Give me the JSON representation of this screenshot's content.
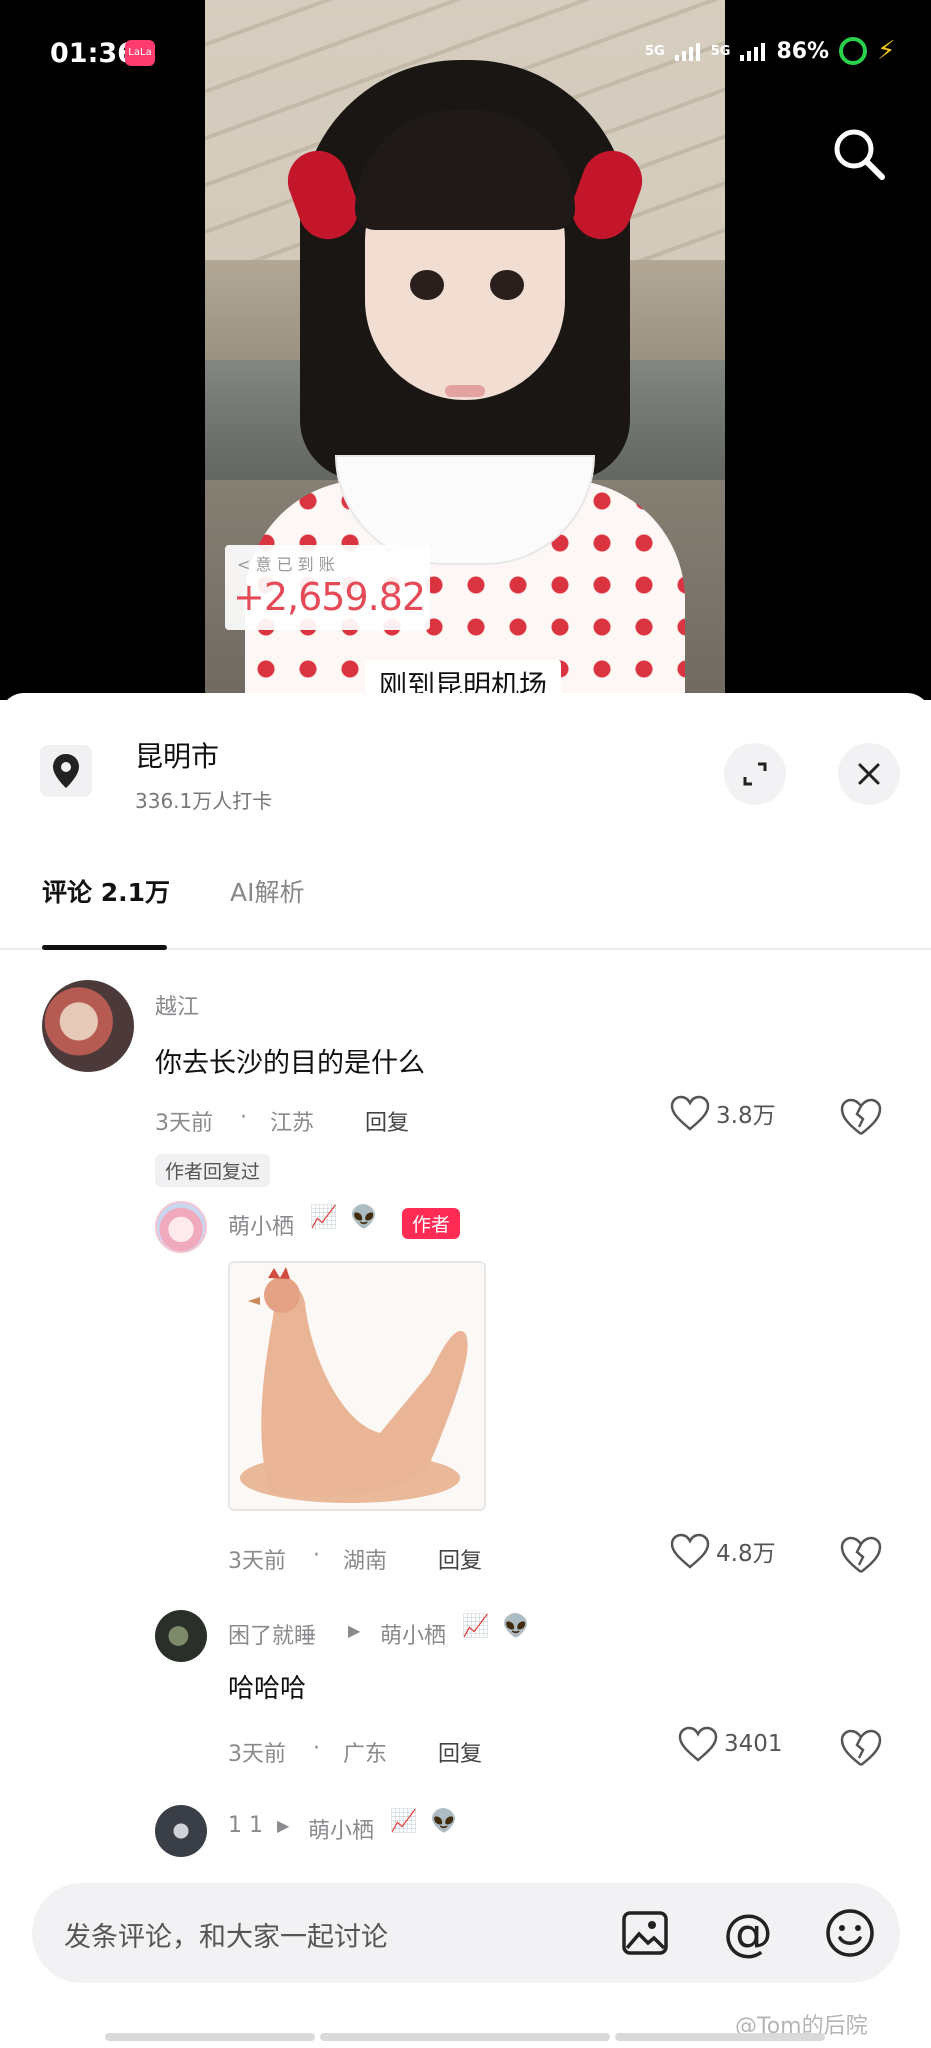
{
  "status": {
    "time": "01:36",
    "app_badge": "LaLa",
    "signal1": "5G",
    "signal2": "5G",
    "battery": "86%"
  },
  "video": {
    "money_sub": "< 意 已 到 账",
    "money": "+2,659.82",
    "caption": "刚到昆明机场"
  },
  "location": {
    "title": "昆明市",
    "subtitle": "336.1万人打卡"
  },
  "tabs": [
    {
      "label": "评论 2.1万"
    },
    {
      "label": "AI解析"
    }
  ],
  "comments": [
    {
      "name": "越江",
      "text": "你去长沙的目的是什么",
      "time": "3天前",
      "dot": "·",
      "region": "江苏",
      "reply": "回复",
      "likes": "3.8万"
    }
  ],
  "author_replied_tag": "作者回复过",
  "replies": [
    {
      "name": "萌小栖",
      "badge": "作者",
      "time": "3天前",
      "dot": "·",
      "region": "湖南",
      "reply": "回复",
      "likes": "4.8万"
    },
    {
      "name": "困了就睡",
      "to": "萌小栖",
      "text": "哈哈哈",
      "time": "3天前",
      "dot": "·",
      "region": "广东",
      "reply": "回复",
      "likes": "3401"
    },
    {
      "name": "1 1",
      "to": "萌小栖"
    }
  ],
  "input": {
    "placeholder": "发条评论，和大家一起讨论",
    "at": "@"
  },
  "watermark": "@Tom的后院",
  "colors": {
    "accent": "#fe2c55",
    "battery": "#2bd04d",
    "money": "#e44b57"
  },
  "icons": [
    "search-icon",
    "location-pin-icon",
    "expand-icon",
    "close-icon",
    "heart-icon",
    "broken-heart-icon",
    "image-icon",
    "at-icon",
    "emoji-icon"
  ]
}
